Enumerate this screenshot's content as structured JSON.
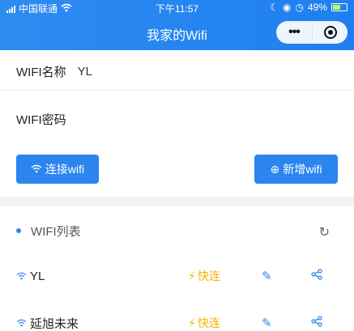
{
  "status_bar": {
    "carrier": "中国联通",
    "time": "下午11:57",
    "battery": "49%"
  },
  "nav": {
    "title": "我家的Wifi"
  },
  "form": {
    "name_label": "WIFI名称",
    "name_value": "YL",
    "password_label": "WIFI密码",
    "password_value": ""
  },
  "buttons": {
    "connect": "连接wifi",
    "add": "新增wifi"
  },
  "list": {
    "title": "WIFI列表",
    "items": [
      {
        "ssid": "YL",
        "quick": "快连"
      },
      {
        "ssid": "延旭未来",
        "quick": "快连"
      }
    ]
  },
  "colors": {
    "accent": "#2b85ee",
    "quick": "#f4b400"
  }
}
